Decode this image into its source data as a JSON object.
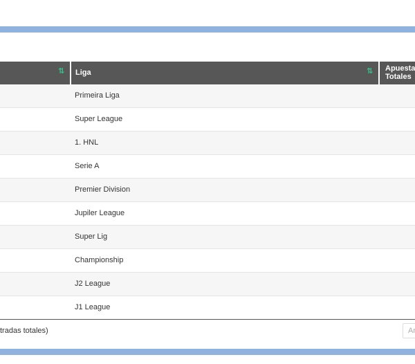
{
  "table": {
    "headers": {
      "col2": "Liga",
      "col3": "Apuestas Totales",
      "sort_glyph": "⇅"
    },
    "rows": [
      {
        "liga": "Primeira Liga"
      },
      {
        "liga": "Super League"
      },
      {
        "liga": "1. HNL"
      },
      {
        "liga": "Serie A"
      },
      {
        "liga": "Premier Division"
      },
      {
        "liga": "Jupiler League"
      },
      {
        "liga": "Super Lig"
      },
      {
        "liga": "Championship"
      },
      {
        "liga": "J2 League"
      },
      {
        "liga": "J1 League"
      }
    ]
  },
  "footer": {
    "info": "tradas totales)",
    "pager_label": "An"
  },
  "colors": {
    "header_bg": "#575757",
    "sort_icon": "#3bbf8c",
    "accent_bar": "#8fb3de"
  }
}
